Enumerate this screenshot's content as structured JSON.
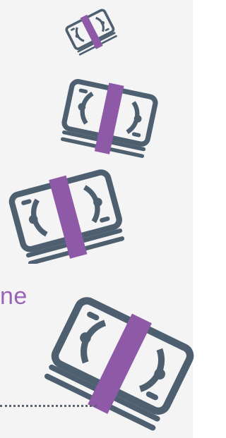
{
  "colors": {
    "panel_background": "#f4f4f5",
    "page_background": "#ffffff",
    "bill_slate": "#4e5f70",
    "bill_band_purple": "#8e5aa8",
    "text_purple": "#9a62b6",
    "dotted_rule": "#5a6470"
  },
  "icons": [
    "money-stack-icon",
    "money-stack-icon",
    "money-stack-icon",
    "money-stack-icon"
  ],
  "cropped_text": "ne"
}
